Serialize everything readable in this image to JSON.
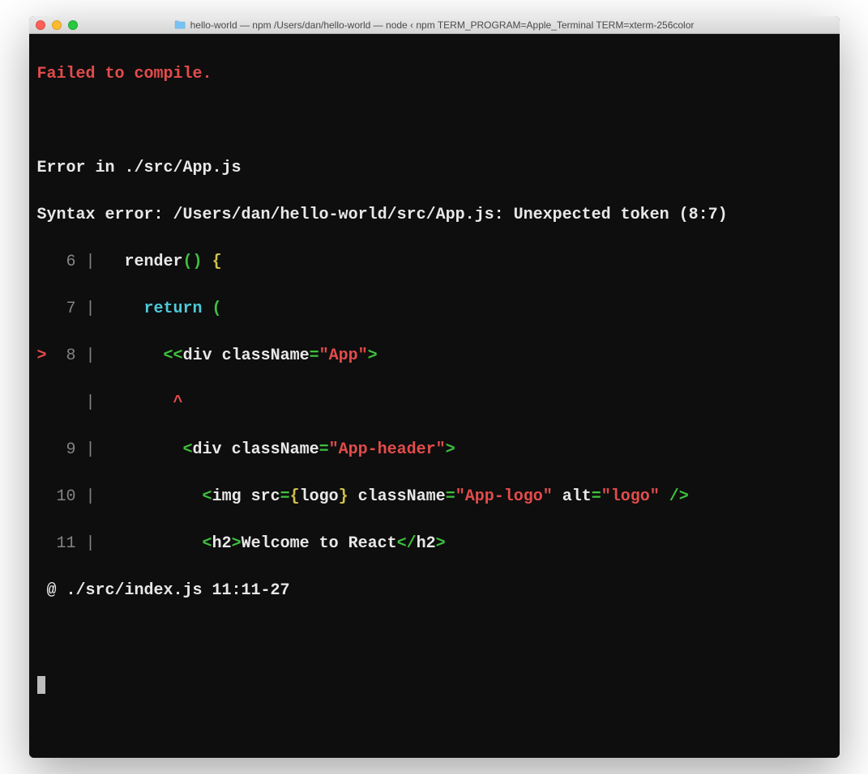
{
  "window": {
    "title": "hello-world — npm  /Users/dan/hello-world — node ‹ npm TERM_PROGRAM=Apple_Terminal TERM=xterm-256color"
  },
  "terminal": {
    "heading": "Failed to compile.",
    "error_in": "Error in ./src/App.js",
    "syntax_error": "Syntax error: /Users/dan/hello-world/src/App.js: Unexpected token (8:7)",
    "lines": {
      "l6": {
        "gutter": "   6 | ",
        "indent": "  ",
        "render": "render",
        "parens": "()",
        "brace": " {"
      },
      "l7": {
        "gutter": "   7 | ",
        "indent": "    ",
        "return": "return",
        "paren": " ("
      },
      "l8": {
        "pointer": ">",
        "gutter": "  8 | ",
        "indent": "      ",
        "open1": "<<",
        "tag": "div",
        "attr": " className",
        "eq": "=",
        "val": "\"App\"",
        "close": ">"
      },
      "caret": {
        "gutter": "     | ",
        "indent": "       ",
        "caret": "^"
      },
      "l9": {
        "gutter": "   9 | ",
        "indent": "        ",
        "open": "<",
        "tag": "div",
        "attr": " className",
        "eq": "=",
        "val": "\"App-header\"",
        "close": ">"
      },
      "l10": {
        "gutter": "  10 | ",
        "indent": "          ",
        "open": "<",
        "tag": "img",
        "attr1": " src",
        "eq1": "=",
        "braceL": "{",
        "expr": "logo",
        "braceR": "}",
        "attr2": " className",
        "eq2": "=",
        "val2": "\"App-logo\"",
        "attr3": " alt",
        "eq3": "=",
        "val3": "\"logo\"",
        "close": " />"
      },
      "l11": {
        "gutter": "  11 | ",
        "indent": "          ",
        "open": "<",
        "tag": "h2",
        "close1": ">",
        "text": "Welcome to React",
        "open2": "</",
        "tag2": "h2",
        "close2": ">"
      }
    },
    "footer": " @ ./src/index.js 11:11-27"
  }
}
